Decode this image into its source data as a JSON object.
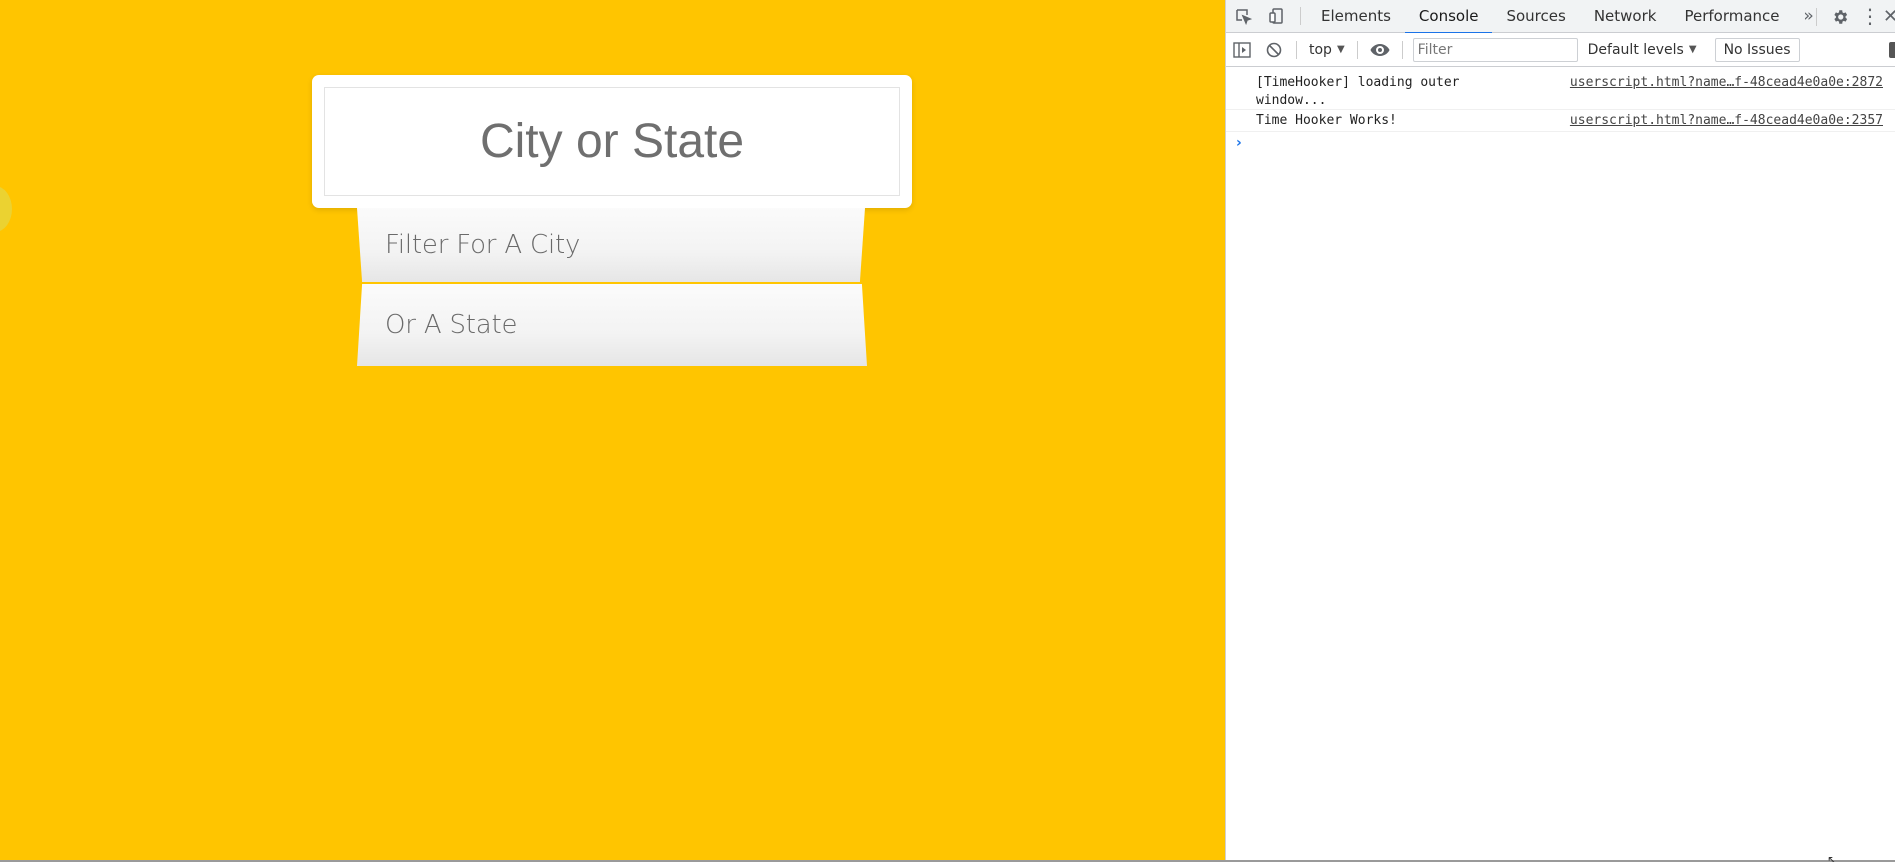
{
  "page": {
    "search": {
      "placeholder": "City or State",
      "value": ""
    },
    "suggestions": [
      "Filter For A City",
      "Or A State"
    ],
    "colors": {
      "background": "#ffc500",
      "card": "#ffffff",
      "text": "#6f6f6f"
    }
  },
  "devtools": {
    "tabs": [
      {
        "label": "Elements",
        "active": false
      },
      {
        "label": "Console",
        "active": true
      },
      {
        "label": "Sources",
        "active": false
      },
      {
        "label": "Network",
        "active": false
      },
      {
        "label": "Performance",
        "active": false
      }
    ],
    "more_tabs": "»",
    "icons": {
      "inspect": "inspect-element-icon",
      "device": "device-toolbar-icon",
      "settings": "gear-icon",
      "menu": "kebab-menu-icon",
      "close": "close-icon"
    },
    "toolbar": {
      "context": "top",
      "filter_placeholder": "Filter",
      "levels": "Default levels",
      "issues": "No Issues"
    },
    "console_messages": [
      {
        "text": "[TimeHooker] loading outer window...",
        "source": "userscript.html?name…f-48cead4e0a0e:2872"
      },
      {
        "text": "Time Hooker Works!",
        "source": "userscript.html?name…f-48cead4e0a0e:2357"
      }
    ],
    "prompt_symbol": "›",
    "accent_color": "#1a73e8"
  }
}
